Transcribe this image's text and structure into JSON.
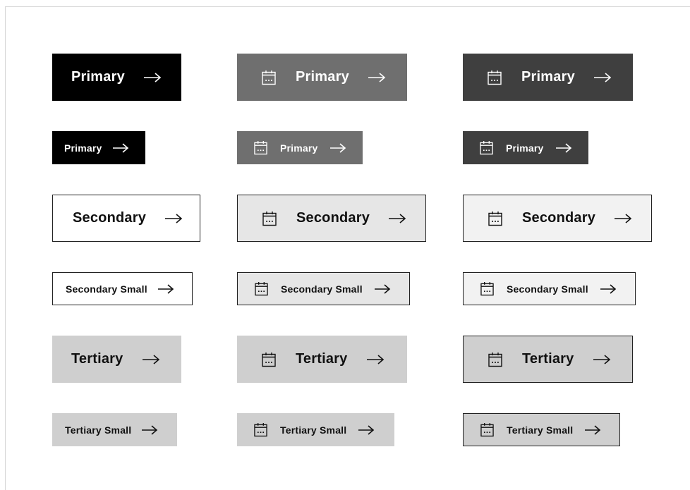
{
  "buttons": {
    "primary": {
      "label": "Primary"
    },
    "secondary": {
      "label": "Secondary"
    },
    "secondary_small": {
      "label": "Secondary Small"
    },
    "tertiary": {
      "label": "Tertiary"
    },
    "tertiary_small": {
      "label": "Tertiary Small"
    }
  },
  "icons": {
    "leading": "calendar-icon",
    "trailing": "arrow-right-icon"
  },
  "colors": {
    "primary_default": "#000000",
    "primary_hover": "#6f6f6f",
    "primary_active": "#3f3f3f",
    "secondary_hover": "#e6e6e6",
    "secondary_active": "#f2f2f2",
    "tertiary": "#cfcfcf",
    "border": "#222222"
  }
}
